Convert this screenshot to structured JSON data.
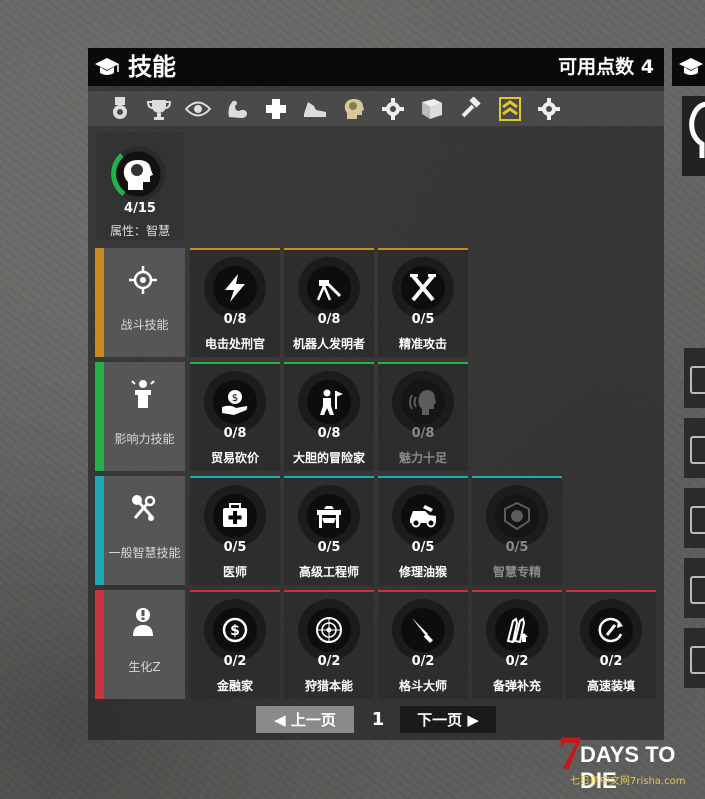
{
  "header": {
    "title": "技能",
    "points_label": "可用点数 4"
  },
  "tabs": [
    {
      "icon": "medal-icon",
      "active": false
    },
    {
      "icon": "trophy-icon",
      "active": false
    },
    {
      "icon": "eye-icon",
      "active": false
    },
    {
      "icon": "muscle-arm-icon",
      "active": false
    },
    {
      "icon": "health-cross-icon",
      "active": false
    },
    {
      "icon": "running-shoe-icon",
      "active": false
    },
    {
      "icon": "brain-head-icon",
      "active": false
    },
    {
      "icon": "gear-icon",
      "active": false
    },
    {
      "icon": "book-icon",
      "active": false
    },
    {
      "icon": "hammer-icon",
      "active": false
    },
    {
      "icon": "rank-chevron-icon",
      "active": true
    },
    {
      "icon": "gear-icon",
      "active": false
    }
  ],
  "attribute": {
    "level": "4/15",
    "name": "属性：智慧",
    "progress": 0.27,
    "icon": "brain-head-icon"
  },
  "rows": [
    {
      "category": "战斗技能",
      "color": "#c98a1f",
      "icon": "crosshair-icon",
      "skills": [
        {
          "level": "0/8",
          "name": "电击处刑官",
          "icon": "lightning-icon",
          "locked": false
        },
        {
          "level": "0/8",
          "name": "机器人发明者",
          "icon": "robot-turret-icon",
          "locked": false
        },
        {
          "level": "0/5",
          "name": "精准攻击",
          "icon": "crossed-batons-icon",
          "locked": false
        }
      ]
    },
    {
      "category": "影响力技能",
      "color": "#25b04a",
      "icon": "podium-speaker-icon",
      "skills": [
        {
          "level": "0/8",
          "name": "贸易砍价",
          "icon": "money-hand-icon",
          "locked": false
        },
        {
          "level": "0/8",
          "name": "大胆的冒险家",
          "icon": "adventurer-flag-icon",
          "locked": false
        },
        {
          "level": "0/8",
          "name": "魅力十足",
          "icon": "speaking-head-icon",
          "locked": true
        }
      ]
    },
    {
      "category": "一般智慧技能",
      "color": "#1fa8b8",
      "icon": "tools-icon",
      "skills": [
        {
          "level": "0/5",
          "name": "医师",
          "icon": "medkit-icon",
          "locked": false
        },
        {
          "level": "0/5",
          "name": "高级工程师",
          "icon": "workbench-icon",
          "locked": false
        },
        {
          "level": "0/5",
          "name": "修理油猴",
          "icon": "car-repair-icon",
          "locked": false
        },
        {
          "level": "0/5",
          "name": "智慧专精",
          "icon": "brain-badge-icon",
          "locked": true
        }
      ]
    },
    {
      "category": "生化Z",
      "color": "#c8343e",
      "icon": "zombie-alert-icon",
      "skills": [
        {
          "level": "0/2",
          "name": "金融家",
          "icon": "dollar-coin-icon",
          "locked": false
        },
        {
          "level": "0/2",
          "name": "狩猎本能",
          "icon": "target-scope-icon",
          "locked": false
        },
        {
          "level": "0/2",
          "name": "格斗大师",
          "icon": "knife-icon",
          "locked": false
        },
        {
          "level": "0/2",
          "name": "备弹补充",
          "icon": "ammo-refill-icon",
          "locked": false
        },
        {
          "level": "0/2",
          "name": "高速装填",
          "icon": "reload-cycle-icon",
          "locked": false
        }
      ]
    }
  ],
  "pagination": {
    "prev": "◀ 上一页",
    "page": "1",
    "next": "下一页 ▶"
  },
  "logo": {
    "number": "7",
    "title": "DAYS TO DIE",
    "subtitle": "七日杀中文网7risha.com"
  }
}
